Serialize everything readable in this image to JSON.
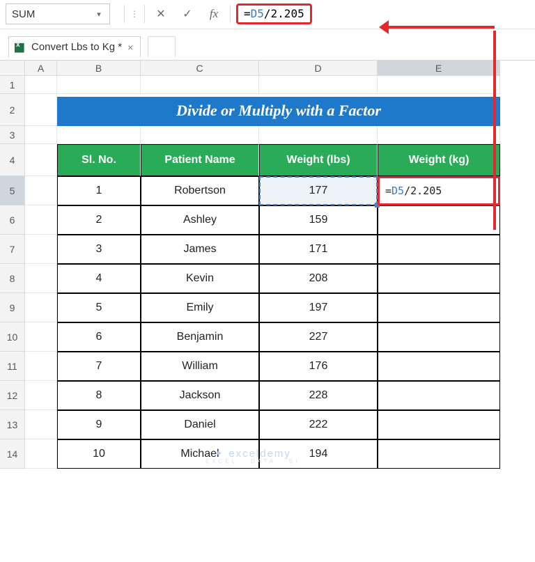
{
  "nameBox": "SUM",
  "formula": "=D5/2.205",
  "tab": {
    "title": "Convert Lbs to Kg *"
  },
  "columns": [
    "A",
    "B",
    "C",
    "D",
    "E"
  ],
  "bannerTitle": "Divide or Multiply with a Factor",
  "table": {
    "headers": [
      "Sl. No.",
      "Patient Name",
      "Weight (lbs)",
      "Weight (kg)"
    ],
    "rows": [
      {
        "sl": 1,
        "name": "Robertson",
        "lbs": 177,
        "kg_editing": "=D5/2.205"
      },
      {
        "sl": 2,
        "name": "Ashley",
        "lbs": 159
      },
      {
        "sl": 3,
        "name": "James",
        "lbs": 171
      },
      {
        "sl": 4,
        "name": "Kevin",
        "lbs": 208
      },
      {
        "sl": 5,
        "name": "Emily",
        "lbs": 197
      },
      {
        "sl": 6,
        "name": "Benjamin",
        "lbs": 227
      },
      {
        "sl": 7,
        "name": "William",
        "lbs": 176
      },
      {
        "sl": 8,
        "name": "Jackson",
        "lbs": 228
      },
      {
        "sl": 9,
        "name": "Daniel",
        "lbs": 222
      },
      {
        "sl": 10,
        "name": "Michael",
        "lbs": 194
      }
    ]
  },
  "active": {
    "row": 5,
    "col": "E",
    "cell": "E5"
  },
  "watermark": {
    "line1": "exceldemy",
    "line2": "EXCEL · DATA · BI"
  },
  "icons": {
    "dropdown": "▾",
    "dots": "⋮",
    "cancel": "✕",
    "confirm": "✓",
    "fx": "fx",
    "close": "×"
  }
}
